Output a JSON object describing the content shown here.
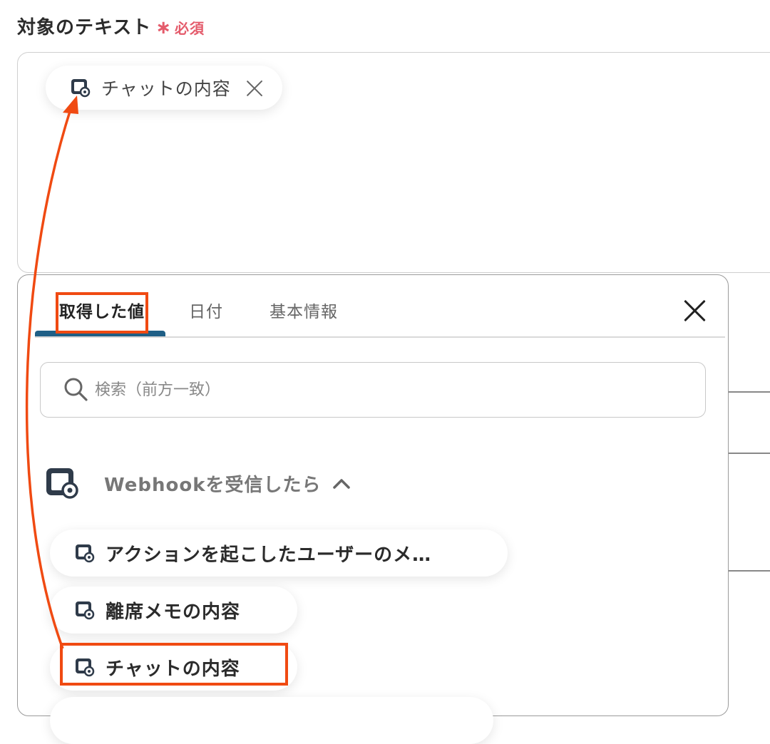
{
  "field": {
    "label": "対象のテキスト",
    "required_mark": "∗",
    "required_text": "必須"
  },
  "selected_chip": {
    "label": "チャットの内容",
    "icon": "webhook-icon"
  },
  "picker": {
    "tabs": [
      {
        "label": "取得した値",
        "active": true
      },
      {
        "label": "日付",
        "active": false
      },
      {
        "label": "基本情報",
        "active": false
      }
    ],
    "search_placeholder": "検索（前方一致）",
    "section": {
      "title": "Webhookを受信したら",
      "icon": "webhook-icon",
      "expanded": true
    },
    "items": [
      {
        "label": "アクションを起こしたユーザーのメ…",
        "icon": "webhook-icon"
      },
      {
        "label": "離席メモの内容",
        "icon": "webhook-icon"
      },
      {
        "label": "チャットの内容",
        "icon": "webhook-icon",
        "highlighted": true
      }
    ]
  },
  "colors": {
    "accent": "#1f5f86",
    "required": "#e45b6b",
    "annotation": "#f04a12",
    "icon": "#2f3b4a"
  }
}
